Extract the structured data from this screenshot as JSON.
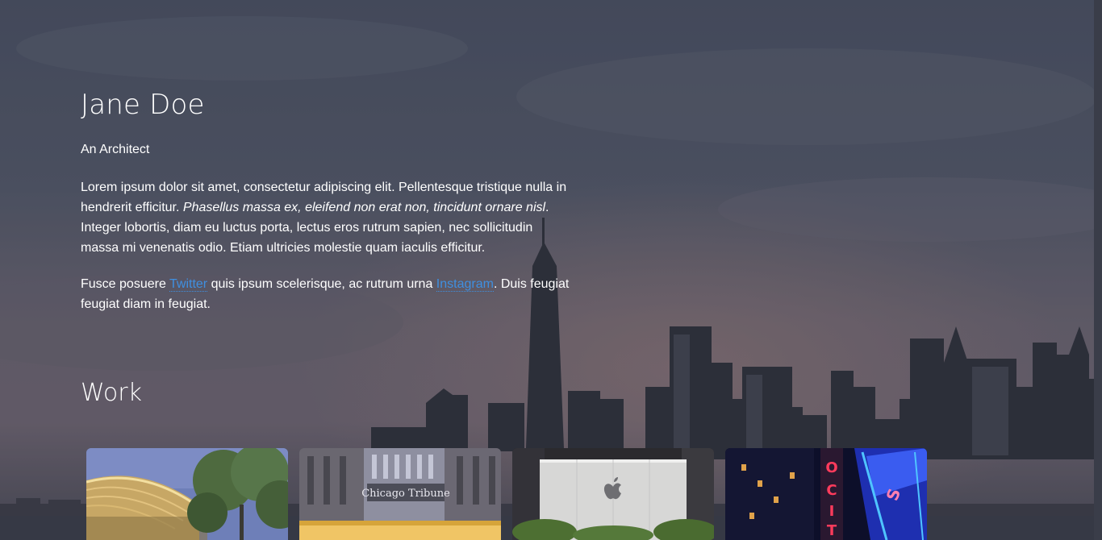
{
  "profile": {
    "name": "Jane Doe",
    "role": "An Architect"
  },
  "intro": {
    "p1_start": "Lorem ipsum dolor sit amet, consectetur adipiscing elit. Pellentesque tristique nulla in hendrerit efficitur. ",
    "p1_italic": "Phasellus massa ex, eleifend non erat non, tincidunt ornare nisl",
    "p1_end": ". Integer lobortis, diam eu luctus porta, lectus eros rutrum sapien, nec sollicitudin massa mi venenatis odio. Etiam ultricies molestie quam iaculis efficitur.",
    "p2_start": "Fusce posuere ",
    "p2_link1": "Twitter",
    "p2_middle": " quis ipsum scelerisque, ac rutrum urna ",
    "p2_link2": "Instagram",
    "p2_end": ". Duis feugiat feugiat diam in feugiat."
  },
  "work": {
    "heading": "Work",
    "items": [
      {
        "icon": "curved-glass-building-photo"
      },
      {
        "icon": "tribune-tower-photo",
        "sign_text": "Chicago Tribune"
      },
      {
        "icon": "apple-store-photo"
      },
      {
        "icon": "neon-sign-photo"
      }
    ]
  },
  "colors": {
    "link": "#3f8fe0",
    "text": "#ffffff"
  }
}
